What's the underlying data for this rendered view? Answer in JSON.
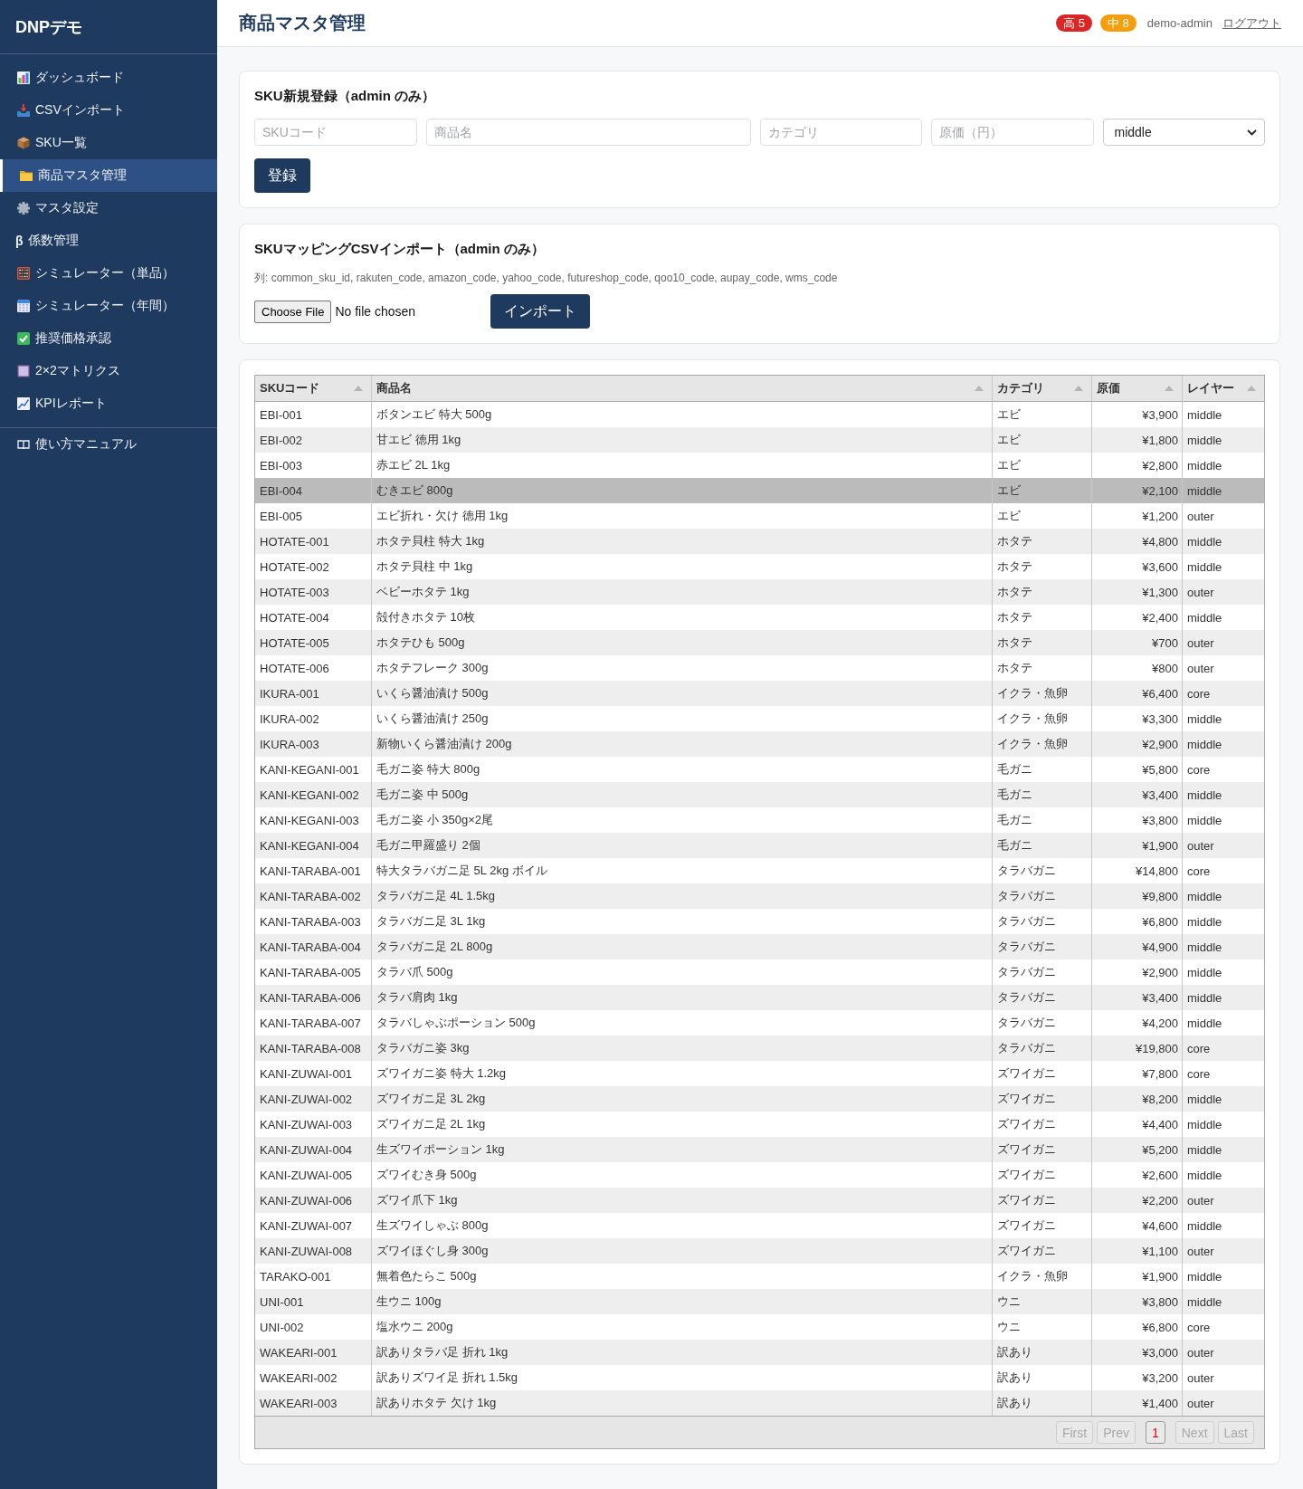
{
  "sidebar": {
    "logo": "DNPデモ",
    "items": [
      {
        "label": "ダッシュボード",
        "selected": false
      },
      {
        "label": "CSVインポート",
        "selected": false
      },
      {
        "label": "SKU一覧",
        "selected": false
      },
      {
        "label": "商品マスタ管理",
        "selected": true
      },
      {
        "label": "マスタ設定",
        "selected": false
      },
      {
        "glyph": "β",
        "label": "係数管理",
        "selected": false
      },
      {
        "label": "シミュレーター（単品）",
        "selected": false
      },
      {
        "label": "シミュレーター（年間）",
        "selected": false
      },
      {
        "label": "推奨価格承認",
        "selected": false
      },
      {
        "label": "2×2マトリクス",
        "selected": false
      },
      {
        "label": "KPIレポート",
        "selected": false
      }
    ],
    "footer_items": [
      {
        "label": "使い方マニュアル",
        "selected": false
      }
    ]
  },
  "header": {
    "title": "商品マスタ管理",
    "alerts": [
      {
        "label": "高 5",
        "color": "#dc2626"
      },
      {
        "label": "中 8",
        "color": "#f59e0b"
      }
    ],
    "user": "demo-admin",
    "logout": "ログアウト"
  },
  "register_card": {
    "title": "SKU新規登録（admin のみ）",
    "fields": [
      {
        "placeholder": "SKUコード"
      },
      {
        "placeholder": "商品名"
      },
      {
        "placeholder": "カテゴリ"
      },
      {
        "placeholder": "原価（円）"
      }
    ],
    "layer_select": {
      "value": "middle"
    },
    "submit": "登録"
  },
  "import_card": {
    "title": "SKUマッピングCSVインポート（admin のみ）",
    "hint": "列: common_sku_id, rakuten_code, amazon_code, yahoo_code, futureshop_code, qoo10_code, aupay_code, wms_code",
    "file_button": "Choose File",
    "file_status": "No file chosen",
    "submit": "インポート"
  },
  "table": {
    "columns": [
      {
        "label": "SKUコード",
        "kind": "text"
      },
      {
        "label": "商品名",
        "kind": "text"
      },
      {
        "label": "カテゴリ",
        "kind": "text"
      },
      {
        "label": "原価",
        "kind": "price"
      },
      {
        "label": "レイヤー",
        "kind": "text"
      }
    ],
    "rows": [
      {
        "cells": [
          "EBI-001",
          "ボタンエビ 特大 500g",
          "エビ",
          "¥3,900",
          "middle"
        ],
        "selected": false
      },
      {
        "cells": [
          "EBI-002",
          "甘エビ 徳用 1kg",
          "エビ",
          "¥1,800",
          "middle"
        ],
        "selected": false
      },
      {
        "cells": [
          "EBI-003",
          "赤エビ 2L 1kg",
          "エビ",
          "¥2,800",
          "middle"
        ],
        "selected": false
      },
      {
        "cells": [
          "EBI-004",
          "むきエビ 800g",
          "エビ",
          "¥2,100",
          "middle"
        ],
        "selected": true
      },
      {
        "cells": [
          "EBI-005",
          "エビ折れ・欠け 徳用 1kg",
          "エビ",
          "¥1,200",
          "outer"
        ],
        "selected": false
      },
      {
        "cells": [
          "HOTATE-001",
          "ホタテ貝柱 特大 1kg",
          "ホタテ",
          "¥4,800",
          "middle"
        ],
        "selected": false
      },
      {
        "cells": [
          "HOTATE-002",
          "ホタテ貝柱 中 1kg",
          "ホタテ",
          "¥3,600",
          "middle"
        ],
        "selected": false
      },
      {
        "cells": [
          "HOTATE-003",
          "ベビーホタテ 1kg",
          "ホタテ",
          "¥1,300",
          "outer"
        ],
        "selected": false
      },
      {
        "cells": [
          "HOTATE-004",
          "殻付きホタテ 10枚",
          "ホタテ",
          "¥2,400",
          "middle"
        ],
        "selected": false
      },
      {
        "cells": [
          "HOTATE-005",
          "ホタテひも 500g",
          "ホタテ",
          "¥700",
          "outer"
        ],
        "selected": false
      },
      {
        "cells": [
          "HOTATE-006",
          "ホタテフレーク 300g",
          "ホタテ",
          "¥800",
          "outer"
        ],
        "selected": false
      },
      {
        "cells": [
          "IKURA-001",
          "いくら醤油漬け 500g",
          "イクラ・魚卵",
          "¥6,400",
          "core"
        ],
        "selected": false
      },
      {
        "cells": [
          "IKURA-002",
          "いくら醤油漬け 250g",
          "イクラ・魚卵",
          "¥3,300",
          "middle"
        ],
        "selected": false
      },
      {
        "cells": [
          "IKURA-003",
          "新物いくら醤油漬け 200g",
          "イクラ・魚卵",
          "¥2,900",
          "middle"
        ],
        "selected": false
      },
      {
        "cells": [
          "KANI-KEGANI-001",
          "毛ガニ姿 特大 800g",
          "毛ガニ",
          "¥5,800",
          "core"
        ],
        "selected": false
      },
      {
        "cells": [
          "KANI-KEGANI-002",
          "毛ガニ姿 中 500g",
          "毛ガニ",
          "¥3,400",
          "middle"
        ],
        "selected": false
      },
      {
        "cells": [
          "KANI-KEGANI-003",
          "毛ガニ姿 小 350g×2尾",
          "毛ガニ",
          "¥3,800",
          "middle"
        ],
        "selected": false
      },
      {
        "cells": [
          "KANI-KEGANI-004",
          "毛ガニ甲羅盛り 2個",
          "毛ガニ",
          "¥1,900",
          "outer"
        ],
        "selected": false
      },
      {
        "cells": [
          "KANI-TARABA-001",
          "特大タラバガニ足 5L 2kg ボイル",
          "タラバガニ",
          "¥14,800",
          "core"
        ],
        "selected": false
      },
      {
        "cells": [
          "KANI-TARABA-002",
          "タラバガニ足 4L 1.5kg",
          "タラバガニ",
          "¥9,800",
          "middle"
        ],
        "selected": false
      },
      {
        "cells": [
          "KANI-TARABA-003",
          "タラバガニ足 3L 1kg",
          "タラバガニ",
          "¥6,800",
          "middle"
        ],
        "selected": false
      },
      {
        "cells": [
          "KANI-TARABA-004",
          "タラバガニ足 2L 800g",
          "タラバガニ",
          "¥4,900",
          "middle"
        ],
        "selected": false
      },
      {
        "cells": [
          "KANI-TARABA-005",
          "タラバ爪 500g",
          "タラバガニ",
          "¥2,900",
          "middle"
        ],
        "selected": false
      },
      {
        "cells": [
          "KANI-TARABA-006",
          "タラバ肩肉 1kg",
          "タラバガニ",
          "¥3,400",
          "middle"
        ],
        "selected": false
      },
      {
        "cells": [
          "KANI-TARABA-007",
          "タラバしゃぶポーション 500g",
          "タラバガニ",
          "¥4,200",
          "middle"
        ],
        "selected": false
      },
      {
        "cells": [
          "KANI-TARABA-008",
          "タラバガニ姿 3kg",
          "タラバガニ",
          "¥19,800",
          "core"
        ],
        "selected": false
      },
      {
        "cells": [
          "KANI-ZUWAI-001",
          "ズワイガニ姿 特大 1.2kg",
          "ズワイガニ",
          "¥7,800",
          "core"
        ],
        "selected": false
      },
      {
        "cells": [
          "KANI-ZUWAI-002",
          "ズワイガニ足 3L 2kg",
          "ズワイガニ",
          "¥8,200",
          "middle"
        ],
        "selected": false
      },
      {
        "cells": [
          "KANI-ZUWAI-003",
          "ズワイガニ足 2L 1kg",
          "ズワイガニ",
          "¥4,400",
          "middle"
        ],
        "selected": false
      },
      {
        "cells": [
          "KANI-ZUWAI-004",
          "生ズワイポーション 1kg",
          "ズワイガニ",
          "¥5,200",
          "middle"
        ],
        "selected": false
      },
      {
        "cells": [
          "KANI-ZUWAI-005",
          "ズワイむき身 500g",
          "ズワイガニ",
          "¥2,600",
          "middle"
        ],
        "selected": false
      },
      {
        "cells": [
          "KANI-ZUWAI-006",
          "ズワイ爪下 1kg",
          "ズワイガニ",
          "¥2,200",
          "outer"
        ],
        "selected": false
      },
      {
        "cells": [
          "KANI-ZUWAI-007",
          "生ズワイしゃぶ 800g",
          "ズワイガニ",
          "¥4,600",
          "middle"
        ],
        "selected": false
      },
      {
        "cells": [
          "KANI-ZUWAI-008",
          "ズワイほぐし身 300g",
          "ズワイガニ",
          "¥1,100",
          "outer"
        ],
        "selected": false
      },
      {
        "cells": [
          "TARAKO-001",
          "無着色たらこ 500g",
          "イクラ・魚卵",
          "¥1,900",
          "middle"
        ],
        "selected": false
      },
      {
        "cells": [
          "UNI-001",
          "生ウニ 100g",
          "ウニ",
          "¥3,800",
          "middle"
        ],
        "selected": false
      },
      {
        "cells": [
          "UNI-002",
          "塩水ウニ 200g",
          "ウニ",
          "¥6,800",
          "core"
        ],
        "selected": false
      },
      {
        "cells": [
          "WAKEARI-001",
          "訳ありタラバ足 折れ 1kg",
          "訳あり",
          "¥3,000",
          "outer"
        ],
        "selected": false
      },
      {
        "cells": [
          "WAKEARI-002",
          "訳ありズワイ足 折れ 1.5kg",
          "訳あり",
          "¥3,200",
          "outer"
        ],
        "selected": false
      },
      {
        "cells": [
          "WAKEARI-003",
          "訳ありホタテ 欠け 1kg",
          "訳あり",
          "¥1,400",
          "outer"
        ],
        "selected": false
      }
    ],
    "pager": [
      {
        "label": "First",
        "kind": "nav",
        "disabled": true,
        "selected": false
      },
      {
        "label": "Prev",
        "kind": "nav",
        "disabled": true,
        "selected": false
      },
      {
        "label": "1",
        "kind": "page",
        "disabled": false,
        "selected": true
      },
      {
        "label": "Next",
        "kind": "nav",
        "disabled": true,
        "selected": false
      },
      {
        "label": "Last",
        "kind": "nav",
        "disabled": true,
        "selected": false
      }
    ]
  }
}
